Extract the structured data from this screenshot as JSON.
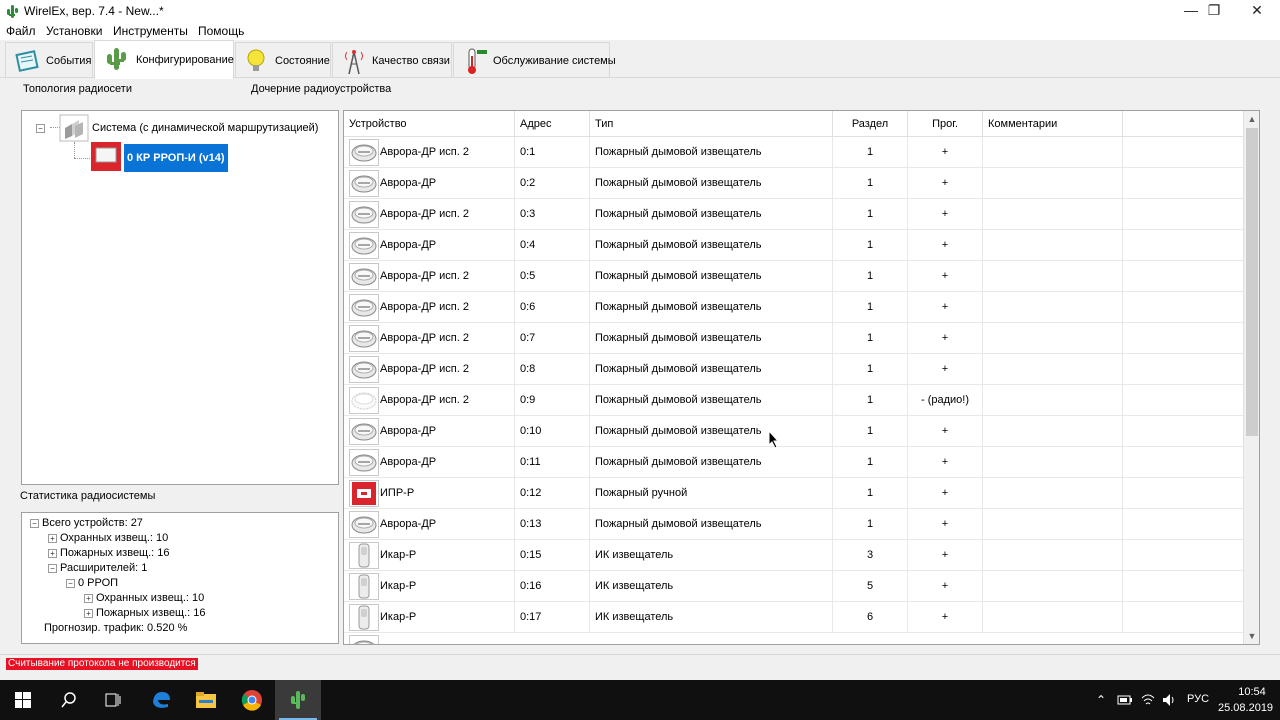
{
  "window": {
    "title": "WirelEx, вер. 7.4 - New...*",
    "minimize_icon": "minimize-icon",
    "restore_icon": "restore-icon",
    "close_icon": "close-icon"
  },
  "menu": [
    "Файл",
    "Установки",
    "Инструменты",
    "Помощь"
  ],
  "tabs": [
    {
      "label": "События",
      "icon": "book-icon"
    },
    {
      "label": "Конфигурирование",
      "icon": "cactus-icon",
      "active": true
    },
    {
      "label": "Состояние",
      "icon": "lightbulb-icon"
    },
    {
      "label": "Качество связи",
      "icon": "antenna-icon"
    },
    {
      "label": "Обслуживание системы",
      "icon": "thermometer-icon"
    }
  ],
  "topology": {
    "label": "Топология радиосети",
    "root": "Система (с динамической маршрутизацией)",
    "child": "0 КР РРОП-И (v14)"
  },
  "child_devices_label": "Дочерние радиоустройства",
  "stats": {
    "label": "Статистика радиосистемы",
    "lines": [
      "Всего устройств: 27",
      "Охранных извещ.: 10",
      "Пожарных извещ.: 16",
      "Расширителей: 1",
      "0 РРОП",
      "Охранных извещ.: 10",
      "Пожарных извещ.: 16",
      "Прогнозир. трафик: 0.520 %"
    ]
  },
  "grid": {
    "columns": [
      "Устройство",
      "Адрес",
      "Тип",
      "Раздел",
      "Прог.",
      "Комментарии"
    ],
    "rows": [
      {
        "device": "Аврора-ДР исп. 2",
        "address": "0:1",
        "type": "Пожарный дымовой извещатель",
        "section": "1",
        "prog": "+",
        "comment": "",
        "icon": "smoke-detector-icon"
      },
      {
        "device": "Аврора-ДР",
        "address": "0:2",
        "type": "Пожарный дымовой извещатель",
        "section": "1",
        "prog": "+",
        "comment": "",
        "icon": "smoke-detector-icon"
      },
      {
        "device": "Аврора-ДР исп. 2",
        "address": "0:3",
        "type": "Пожарный дымовой извещатель",
        "section": "1",
        "prog": "+",
        "comment": "",
        "icon": "smoke-detector-icon"
      },
      {
        "device": "Аврора-ДР",
        "address": "0:4",
        "type": "Пожарный дымовой извещатель",
        "section": "1",
        "prog": "+",
        "comment": "",
        "icon": "smoke-detector-icon"
      },
      {
        "device": "Аврора-ДР исп. 2",
        "address": "0:5",
        "type": "Пожарный дымовой извещатель",
        "section": "1",
        "prog": "+",
        "comment": "",
        "icon": "smoke-detector-icon"
      },
      {
        "device": "Аврора-ДР исп. 2",
        "address": "0:6",
        "type": "Пожарный дымовой извещатель",
        "section": "1",
        "prog": "+",
        "comment": "",
        "icon": "smoke-detector-icon"
      },
      {
        "device": "Аврора-ДР исп. 2",
        "address": "0:7",
        "type": "Пожарный дымовой извещатель",
        "section": "1",
        "prog": "+",
        "comment": "",
        "icon": "smoke-detector-icon"
      },
      {
        "device": "Аврора-ДР исп. 2",
        "address": "0:8",
        "type": "Пожарный дымовой извещатель",
        "section": "1",
        "prog": "+",
        "comment": "",
        "icon": "smoke-detector-icon"
      },
      {
        "device": "Аврора-ДР исп. 2",
        "address": "0:9",
        "type": "Пожарный дымовой извещатель",
        "section": "1",
        "prog": "- (радио!)",
        "comment": "",
        "icon": "smoke-detector-faded-icon"
      },
      {
        "device": "Аврора-ДР",
        "address": "0:10",
        "type": "Пожарный дымовой извещатель",
        "section": "1",
        "prog": "+",
        "comment": "",
        "icon": "smoke-detector-icon"
      },
      {
        "device": "Аврора-ДР",
        "address": "0:11",
        "type": "Пожарный дымовой извещатель",
        "section": "1",
        "prog": "+",
        "comment": "",
        "icon": "smoke-detector-icon"
      },
      {
        "device": "ИПР-Р",
        "address": "0:12",
        "type": "Пожарный ручной",
        "section": "1",
        "prog": "+",
        "comment": "",
        "icon": "manual-call-point-icon"
      },
      {
        "device": "Аврора-ДР",
        "address": "0:13",
        "type": "Пожарный дымовой извещатель",
        "section": "1",
        "prog": "+",
        "comment": "",
        "icon": "smoke-detector-icon"
      },
      {
        "device": "Икар-Р",
        "address": "0:15",
        "type": "ИК извещатель",
        "section": "3",
        "prog": "+",
        "comment": "",
        "icon": "ir-detector-icon"
      },
      {
        "device": "Икар-Р",
        "address": "0:16",
        "type": "ИК извещатель",
        "section": "5",
        "prog": "+",
        "comment": "",
        "icon": "ir-detector-icon"
      },
      {
        "device": "Икар-Р",
        "address": "0:17",
        "type": "ИК извещатель",
        "section": "6",
        "prog": "+",
        "comment": "",
        "icon": "ir-detector-icon"
      }
    ]
  },
  "status": {
    "message": "Считывание протокола не производится",
    "color": "#e81123"
  },
  "taskbar": {
    "items": [
      "windows-start-icon",
      "search-icon",
      "task-view-icon",
      "edge-icon",
      "file-explorer-icon",
      "chrome-icon",
      "wirelex-icon"
    ],
    "language": "РУС",
    "time": "10:54",
    "date": "25.08.2019"
  }
}
